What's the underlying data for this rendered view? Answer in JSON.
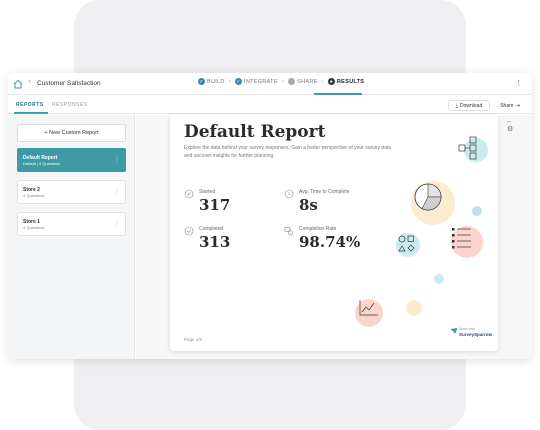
{
  "header": {
    "survey_title": "Customer Satisfaction",
    "steps": [
      {
        "label": "BUILD",
        "state": "done"
      },
      {
        "label": "INTEGRATE",
        "state": "done"
      },
      {
        "label": "SHARE",
        "state": "todo"
      },
      {
        "label": "RESULTS",
        "state": "active"
      }
    ]
  },
  "subbar": {
    "tabs": [
      "REPORTS",
      "RESPONSES"
    ],
    "download_label": "Download",
    "share_label": "Share"
  },
  "sidebar": {
    "new_button_label": "+ New Custom Report",
    "reports": [
      {
        "title": "Default Report",
        "subtitle": "Default | 4 Questions",
        "selected": true
      },
      {
        "title": "Store 2",
        "subtitle": "4 Questions",
        "selected": false
      },
      {
        "title": "Store 1",
        "subtitle": "4 Questions",
        "selected": false
      }
    ]
  },
  "report": {
    "title": "Default Report",
    "description": "Explore the data behind your survey responses. Gain a better perspective of your survey data and uncover insights for further planning.",
    "stats": [
      {
        "label": "Started",
        "value": "317",
        "icon": "start-icon"
      },
      {
        "label": "Avg. Time to Complete",
        "value": "8s",
        "icon": "clock-icon"
      },
      {
        "label": "Completed",
        "value": "313",
        "icon": "check-circle-icon"
      },
      {
        "label": "Completion Rate",
        "value": "98.74%",
        "icon": "rate-icon"
      }
    ],
    "page_label": "Page 1/5",
    "brand_small": "Made with",
    "brand_name": "SurveySparrow"
  },
  "colors": {
    "accent": "#3d9aa6",
    "link_blue": "#3a86b0",
    "pastel_teal": "#c8ecef",
    "pastel_yellow": "#fbecd0",
    "pastel_pink": "#fbd5cd",
    "pastel_blue": "#bfe0ee"
  }
}
